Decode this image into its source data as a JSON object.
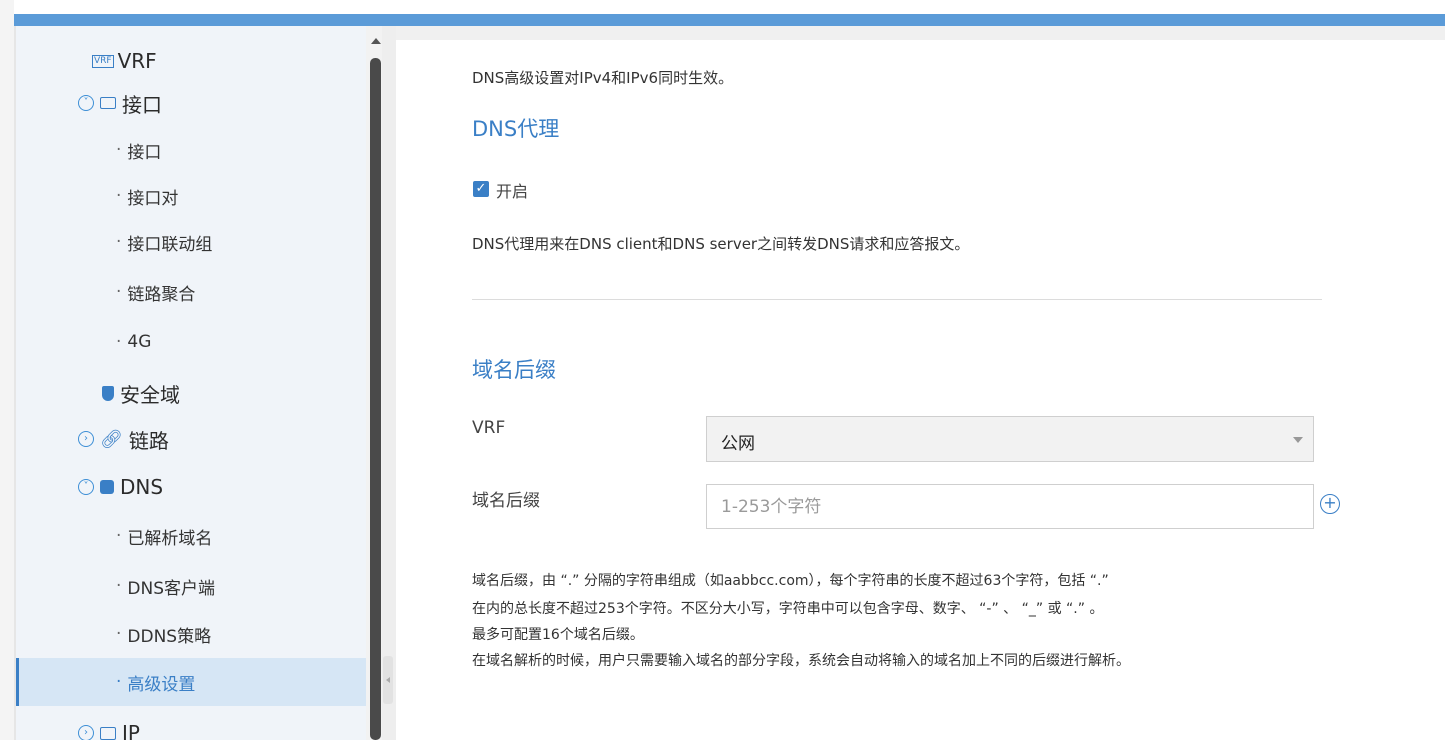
{
  "sidebar": {
    "vrf": "VRF",
    "interface_group": "接口",
    "interface_items": [
      "接口",
      "接口对",
      "接口联动组",
      "链路聚合",
      "4G"
    ],
    "security_zone": "安全域",
    "link": "链路",
    "dns": "DNS",
    "dns_items": [
      "已解析域名",
      "DNS客户端",
      "DDNS策略",
      "高级设置"
    ],
    "ip": "IP",
    "vrf_icon_text": "VRF"
  },
  "content": {
    "intro": "DNS高级设置对IPv4和IPv6同时生效。",
    "dns_proxy_heading": "DNS代理",
    "enable_label": "开启",
    "enable_checked": true,
    "proxy_desc": "DNS代理用来在DNS client和DNS server之间转发DNS请求和应答报文。",
    "suffix_heading": "域名后缀",
    "vrf_label": "VRF",
    "vrf_value": "公网",
    "suffix_label": "域名后缀",
    "suffix_placeholder": "1-253个字符",
    "help_lines": [
      "域名后缀，由 “.” 分隔的字符串组成（如aabbcc.com），每个字符串的长度不超过63个字符，包括 “.”",
      "在内的总长度不超过253个字符。不区分大小写，字符串中可以包含字母、数字、 “-” 、 “_” 或 “.” 。",
      "最多可配置16个域名后缀。",
      "在域名解析的时候，用户只需要输入域名的部分字段，系统会自动将输入的域名加上不同的后缀进行解析。"
    ]
  },
  "colors": {
    "accent": "#3a7fc6",
    "topbar": "#5b9bd8",
    "sidebar_bg": "#f0f4f9",
    "active_bg": "#d6e6f5"
  }
}
